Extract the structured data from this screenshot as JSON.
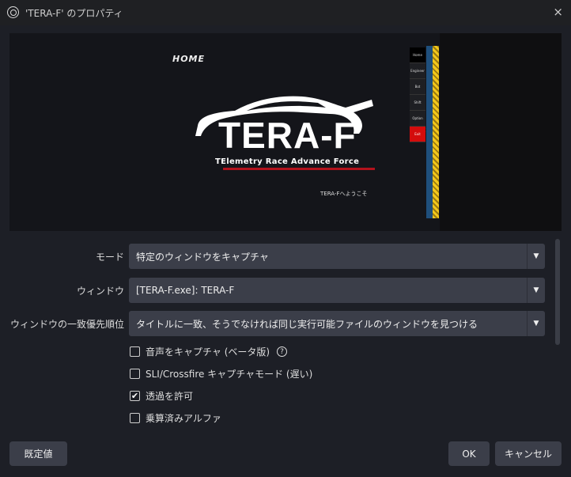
{
  "window": {
    "title": "'TERA-F' のプロパティ",
    "close_icon": "×"
  },
  "preview": {
    "home_label": "HOME",
    "logo_text": "TERA-F",
    "subtitle": "TElemetry Race Advance Force",
    "welcome": "TERA-Fへようこそ",
    "menu": [
      "Home",
      "Engineer",
      "Bot",
      "Shift",
      "Option",
      "Exit"
    ],
    "accent_red": "#d40c0c"
  },
  "form": {
    "mode": {
      "label": "モード",
      "value": "特定のウィンドウをキャプチャ"
    },
    "window": {
      "label": "ウィンドウ",
      "value": "[TERA-F.exe]: TERA-F"
    },
    "priority": {
      "label": "ウィンドウの一致優先順位",
      "value": "タイトルに一致、そうでなければ同じ実行可能ファイルのウィンドウを見つける"
    },
    "checkboxes": [
      {
        "label": "音声をキャプチャ (ベータ版)",
        "checked": false
      },
      {
        "label": "SLI/Crossfire キャプチャモード (遅い)",
        "checked": false
      },
      {
        "label": "透過を許可",
        "checked": true
      },
      {
        "label": "乗算済みアルファ",
        "checked": false
      }
    ]
  },
  "buttons": {
    "defaults": "既定値",
    "ok": "OK",
    "cancel": "キャンセル"
  }
}
